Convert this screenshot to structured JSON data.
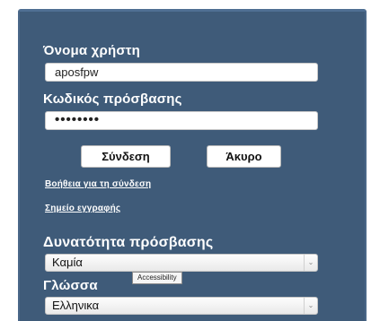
{
  "login": {
    "username_label": "Όνομα χρήστη",
    "username_value": "aposfpw",
    "password_label": "Κωδικός πρόσβασης",
    "password_value": "••••••••",
    "login_button": "Σύνδεση",
    "cancel_button": "Άκυρο",
    "help_link": "Βοήθεια για τη σύνδεση",
    "register_link": "Σημείο εγγραφής"
  },
  "accessibility": {
    "label": "Δυνατότητα πρόσβασης",
    "selected": "Καμία",
    "tooltip": "Accessibility"
  },
  "language": {
    "label": "Γλώσσα",
    "selected": "Ελληνικα"
  },
  "icons": {
    "dropdown": "chevron-down-icon"
  },
  "colors": {
    "panel_background": "#3f5b79"
  }
}
